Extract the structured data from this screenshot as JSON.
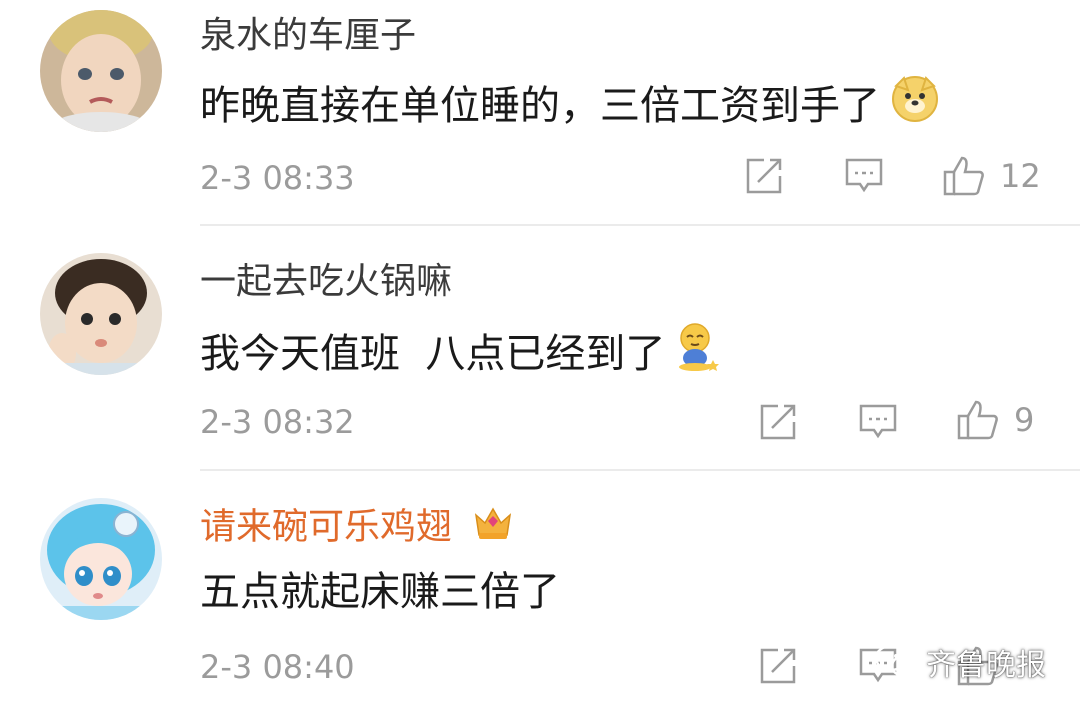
{
  "comments": [
    {
      "username": "泉水的车厘子",
      "text": "昨晚直接在单位睡的，三倍工资到手了",
      "emoji": "doge-emoji",
      "time": "2-3 08:33",
      "likes": "12",
      "vip": false
    },
    {
      "username": "一起去吃火锅嘛",
      "text": "我今天值班  八点已经到了",
      "emoji": "sitting-shy-emoji",
      "time": "2-3 08:32",
      "likes": "9",
      "vip": false
    },
    {
      "username": "请来碗可乐鸡翅",
      "text": "五点就起床赚三倍了",
      "emoji": null,
      "time": "2-3 08:40",
      "likes": "",
      "vip": true,
      "badge": "crown-badge-icon"
    }
  ],
  "icons": {
    "share": "share-icon",
    "comment": "comment-icon",
    "like": "thumbs-up-icon"
  },
  "watermark": {
    "text": "齐鲁晚报",
    "icon": "wechat-icon"
  },
  "colors": {
    "username": "#3b3b3b",
    "vip_username": "#e06a2b",
    "meta": "#9b9b9b",
    "divider": "#ebebeb"
  }
}
